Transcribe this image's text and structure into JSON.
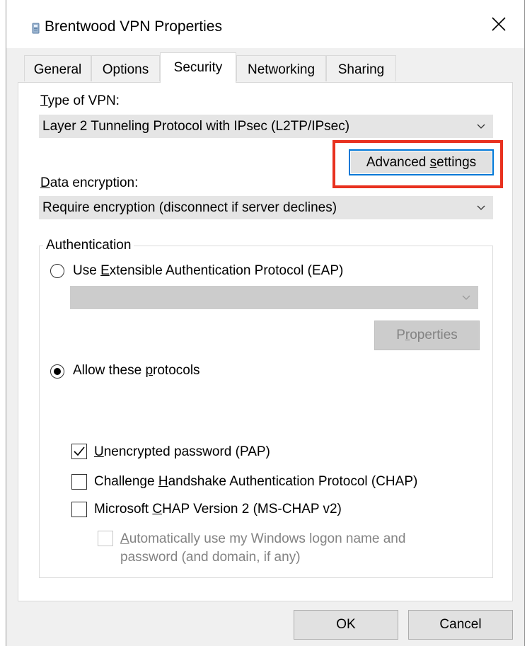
{
  "window": {
    "title": "Brentwood VPN Properties",
    "close_icon": "close-icon",
    "title_icon": "vpn-connection-icon"
  },
  "tabs": [
    {
      "label": "General",
      "active": false
    },
    {
      "label": "Options",
      "active": false
    },
    {
      "label": "Security",
      "active": true
    },
    {
      "label": "Networking",
      "active": false
    },
    {
      "label": "Sharing",
      "active": false
    }
  ],
  "security": {
    "vpn_type_label": "Type of VPN:",
    "vpn_type_value": "Layer 2 Tunneling Protocol with IPsec (L2TP/IPsec)",
    "advanced_settings_label": "Advanced settings",
    "encryption_label": "Data encryption:",
    "encryption_value": "Require encryption (disconnect if server declines)",
    "authentication": {
      "legend": "Authentication",
      "eap_option": {
        "label": "Use Extensible Authentication Protocol (EAP)",
        "selected": false
      },
      "eap_value": "",
      "properties_label": "Properties",
      "protocols_option": {
        "label": "Allow these protocols",
        "selected": true
      },
      "protocols": [
        {
          "label": "Unencrypted password (PAP)",
          "checked": true,
          "enabled": true
        },
        {
          "label": "Challenge Handshake Authentication Protocol (CHAP)",
          "checked": false,
          "enabled": true
        },
        {
          "label": "Microsoft CHAP Version 2 (MS-CHAP v2)",
          "checked": false,
          "enabled": true
        }
      ],
      "auto_logon": {
        "label_line1": "Automatically use my Windows logon name and",
        "label_line2": "password (and domain, if any)",
        "checked": false,
        "enabled": false
      }
    }
  },
  "buttons": {
    "ok": "OK",
    "cancel": "Cancel"
  },
  "colors": {
    "highlight": "#e8311f",
    "focus": "#0078d7",
    "dialog_bg": "#f0f0f0"
  }
}
